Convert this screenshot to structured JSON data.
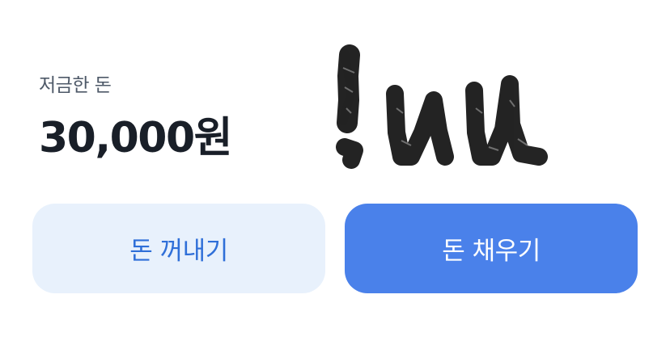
{
  "balance": {
    "label": "저금한 돈",
    "amount": "30,000원"
  },
  "actions": {
    "withdraw_label": "돈 꺼내기",
    "deposit_label": "돈 채우기"
  },
  "colors": {
    "primary": "#4a81ea",
    "primary_light": "#e8f1fc",
    "text_primary": "#191f28",
    "text_secondary": "#4e5968"
  }
}
